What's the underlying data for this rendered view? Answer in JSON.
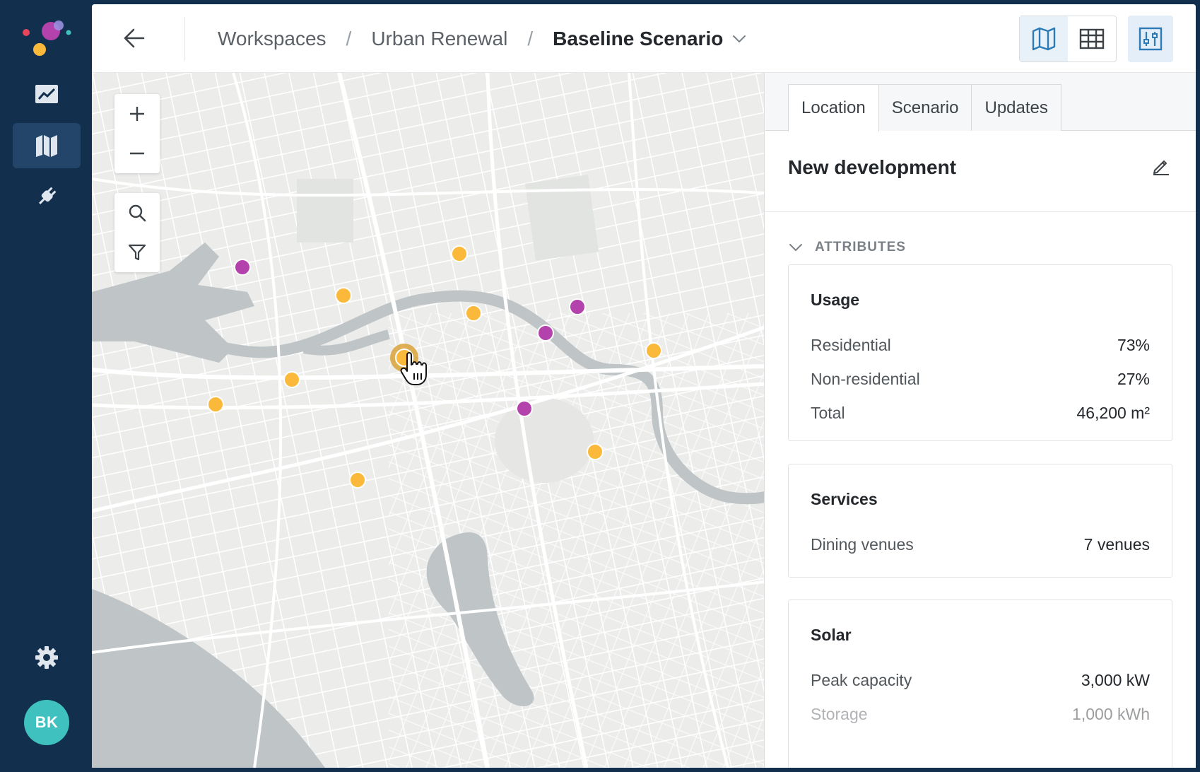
{
  "header": {
    "breadcrumbs": [
      "Workspaces",
      "Urban Renewal",
      "Baseline Scenario"
    ],
    "separator": "/"
  },
  "user": {
    "initials": "BK"
  },
  "brand_colors": {
    "rail": "#12304e",
    "accent": "#2d7bb6",
    "marker_orange": "#fbb93b",
    "marker_purple": "#b442ad"
  },
  "panel": {
    "tabs": [
      "Location",
      "Scenario",
      "Updates"
    ],
    "active_tab": "Location",
    "title": "New development",
    "section_label": "ATTRIBUTES",
    "cards": [
      {
        "title": "Usage",
        "rows": [
          {
            "label": "Residential",
            "value": "73%"
          },
          {
            "label": "Non-residential",
            "value": "27%"
          },
          {
            "label": "Total",
            "value": "46,200 m²"
          }
        ]
      },
      {
        "title": "Services",
        "rows": [
          {
            "label": "Dining venues",
            "value": "7 venues"
          }
        ]
      },
      {
        "title": "Solar",
        "rows": [
          {
            "label": "Peak capacity",
            "value": "3,000 kW"
          },
          {
            "label": "Storage",
            "value": "1,000 kWh"
          }
        ]
      }
    ]
  },
  "icons": {
    "rail": [
      "trend-chart-icon",
      "map-icon",
      "plug-icon",
      "gear-icon"
    ],
    "header": [
      "back-arrow-icon",
      "chevron-down-icon",
      "map-view-icon",
      "table-view-icon",
      "sliders-icon"
    ],
    "map_controls": [
      "zoom-in-icon",
      "zoom-out-icon",
      "search-icon",
      "filter-icon"
    ]
  }
}
